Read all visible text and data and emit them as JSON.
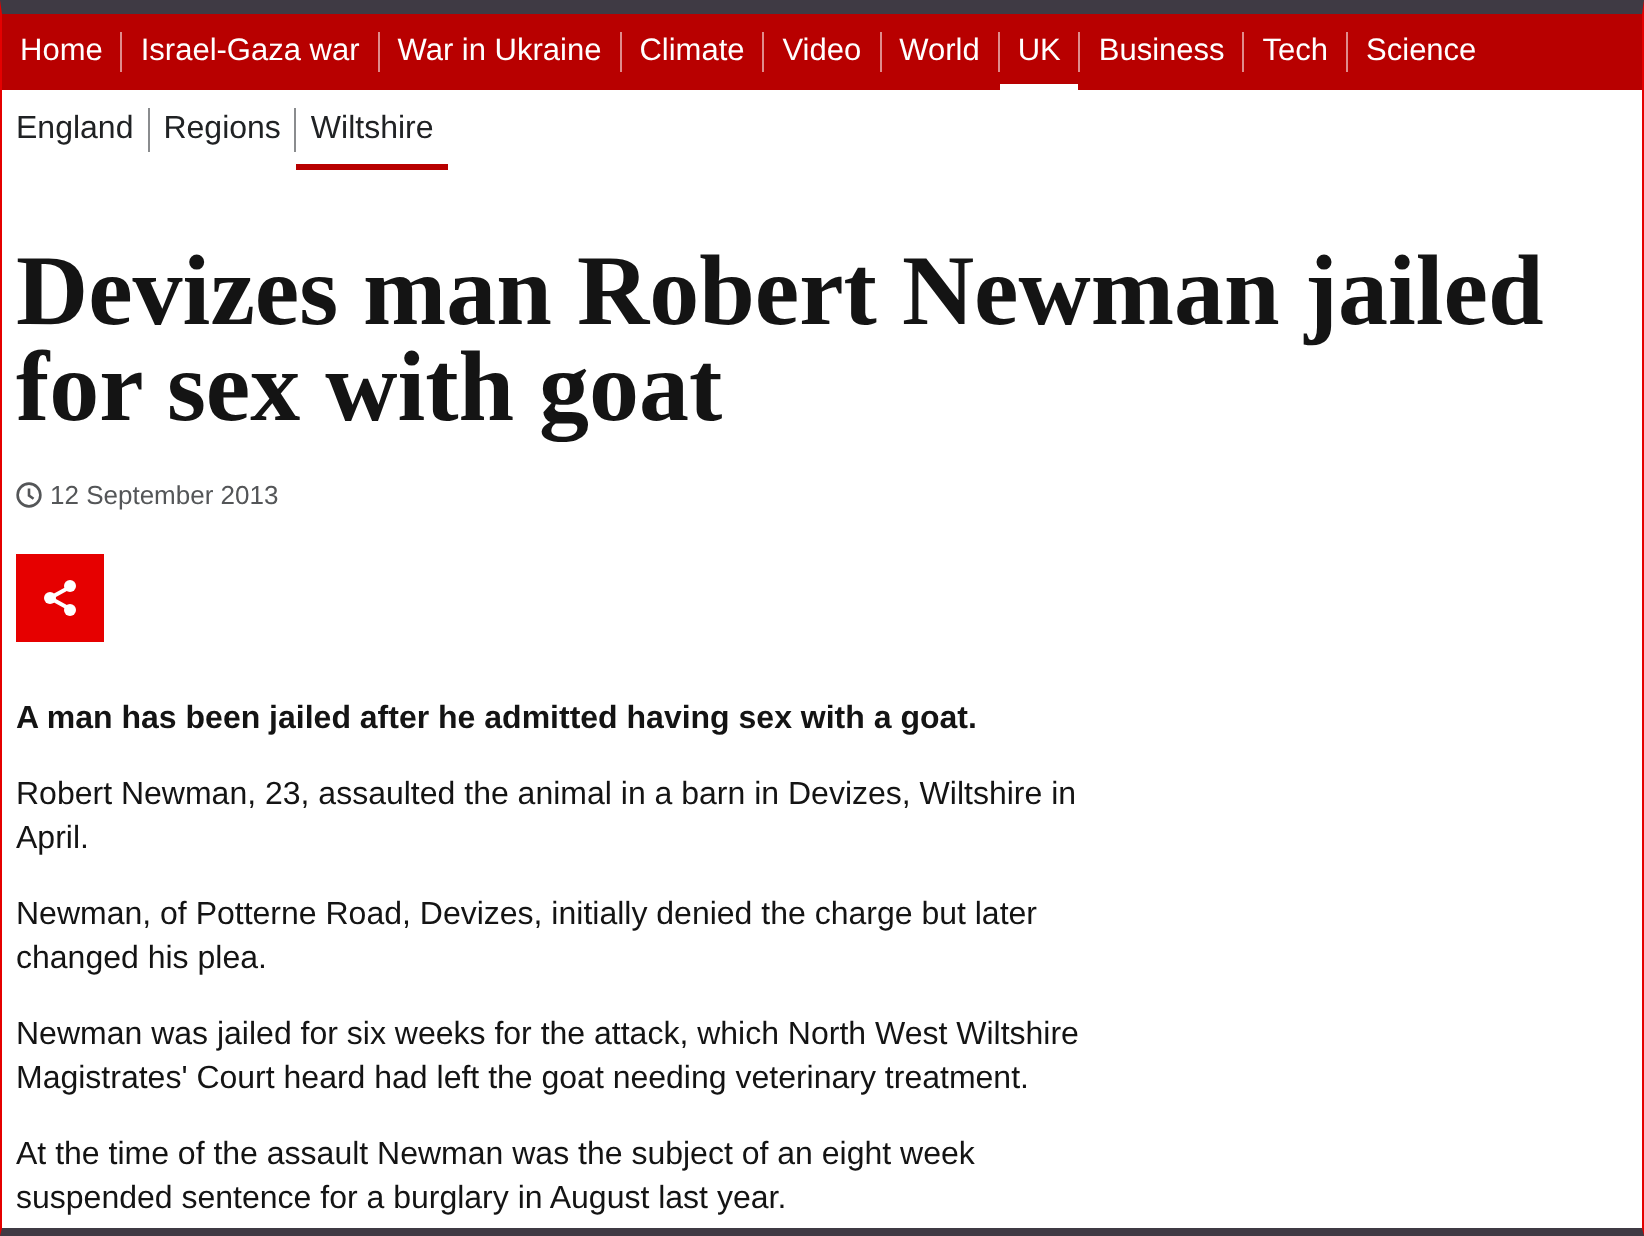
{
  "nav": {
    "items": [
      {
        "label": "Home",
        "selected": false
      },
      {
        "label": "Israel-Gaza war",
        "selected": false
      },
      {
        "label": "War in Ukraine",
        "selected": false
      },
      {
        "label": "Climate",
        "selected": false
      },
      {
        "label": "Video",
        "selected": false
      },
      {
        "label": "World",
        "selected": false
      },
      {
        "label": "UK",
        "selected": true
      },
      {
        "label": "Business",
        "selected": false
      },
      {
        "label": "Tech",
        "selected": false
      },
      {
        "label": "Science",
        "selected": false
      }
    ]
  },
  "subnav": {
    "items": [
      {
        "label": "England",
        "selected": false
      },
      {
        "label": "Regions",
        "selected": false
      },
      {
        "label": "Wiltshire",
        "selected": true
      }
    ]
  },
  "article": {
    "headline": "Devizes man Robert Newman jailed for sex with goat",
    "date": "12 September 2013",
    "paragraphs": [
      {
        "kind": "lead",
        "text": "A man has been jailed after he admitted having sex with a goat."
      },
      {
        "kind": "body",
        "text": "Robert Newman, 23, assaulted the animal in a barn in Devizes, Wiltshire in April."
      },
      {
        "kind": "body",
        "text": "Newman, of Potterne Road, Devizes, initially denied the charge but later changed his plea."
      },
      {
        "kind": "body",
        "text": "Newman was jailed for six weeks for the attack, which North West Wiltshire Magistrates' Court heard had left the goat needing veterinary treatment."
      },
      {
        "kind": "body",
        "text": "At the time of the assault Newman was the subject of an eight week suspended sentence for a burglary in August last year."
      }
    ]
  }
}
